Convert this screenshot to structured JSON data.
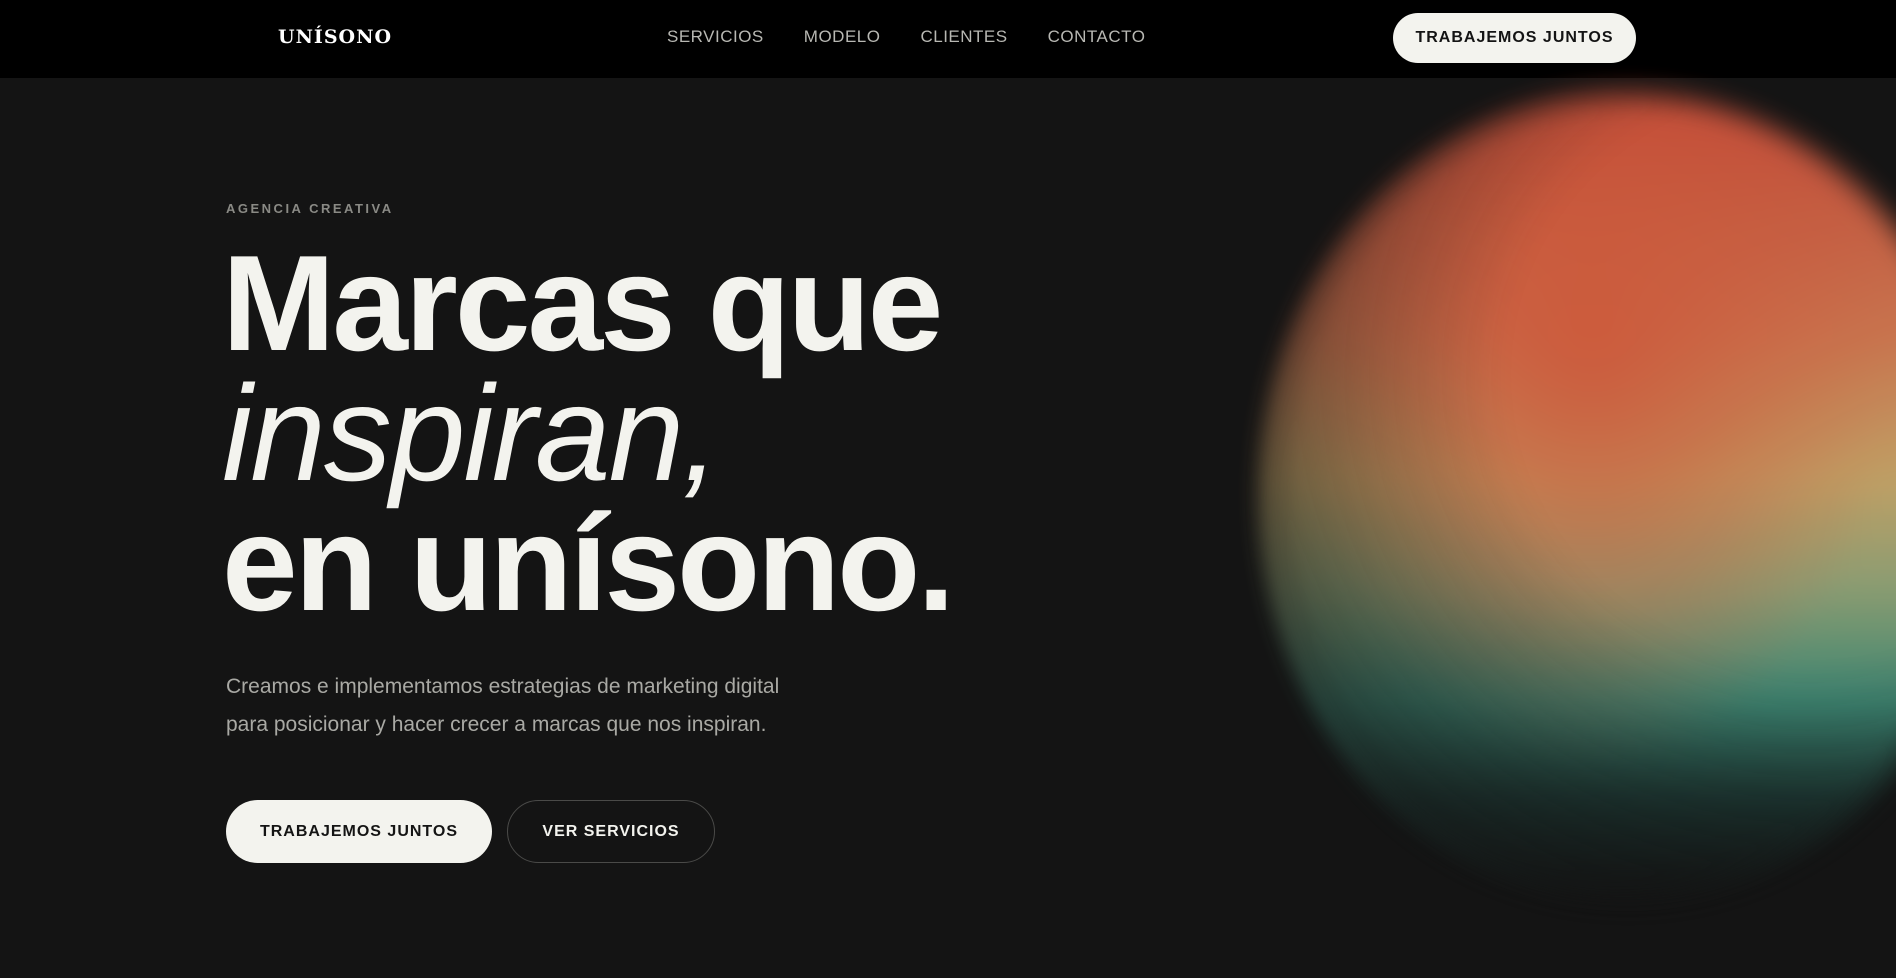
{
  "header": {
    "logo": "UNÍSONO",
    "nav": [
      {
        "label": "SERVICIOS"
      },
      {
        "label": "MODELO"
      },
      {
        "label": "CLIENTES"
      },
      {
        "label": "CONTACTO"
      }
    ],
    "cta_label": "TRABAJEMOS JUNTOS"
  },
  "hero": {
    "eyebrow": "AGENCIA CREATIVA",
    "headline_line1": "Marcas que",
    "headline_line2": "inspiran,",
    "headline_line3": "en unísono.",
    "subtitle_line1": "Creamos e implementamos estrategias de marketing digital",
    "subtitle_line2": "para posicionar y hacer crecer a marcas que nos inspiran.",
    "primary_cta": "TRABAJEMOS JUNTOS",
    "secondary_cta": "VER SERVICIOS"
  },
  "colors": {
    "background": "#141414",
    "header_bg": "#000000",
    "text_primary": "#f3f3ee",
    "text_muted": "#a9a9a4",
    "button_fill": "#f3f3ee"
  }
}
